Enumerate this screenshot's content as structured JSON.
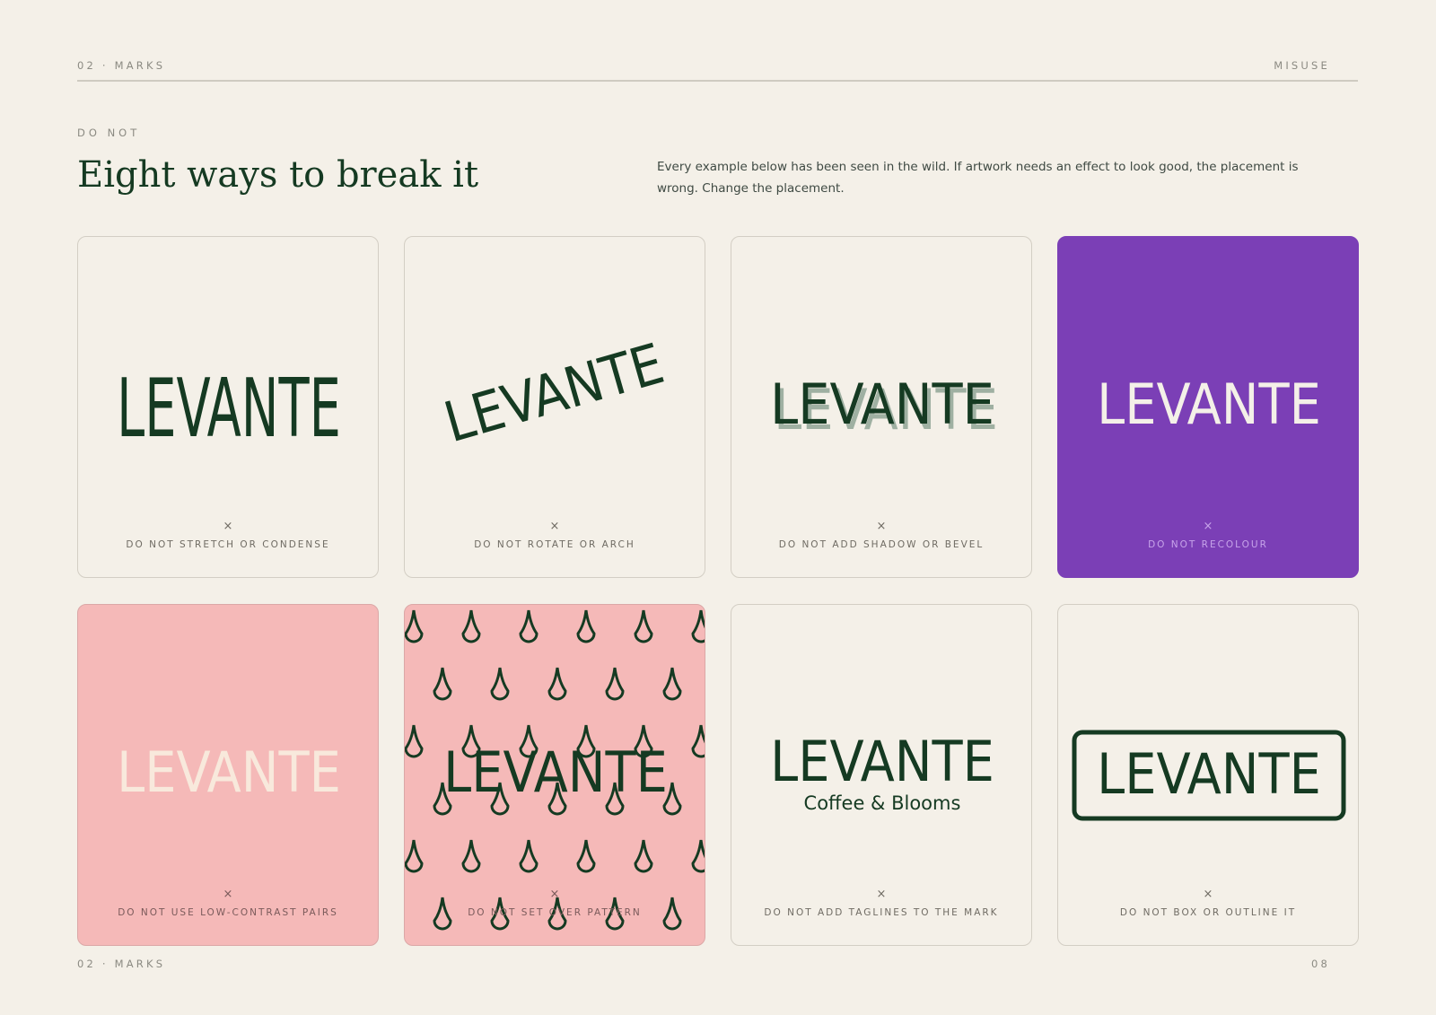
{
  "header": {
    "section": "02 · MARKS",
    "page_label": "MISUSE"
  },
  "kicker": "DO NOT",
  "title": "Eight ways to break it",
  "intro": "Every example below has been seen in the wild. If artwork needs an effect to look good, the placement is wrong. Change the placement.",
  "logo_word": "LEVANTE",
  "tagline": "Coffee & Blooms",
  "mark_glyph": "×",
  "colors": {
    "brand_green": "#153a22",
    "cream": "#f4f0e8",
    "purple": "#7b3fb6",
    "pink": "#f5b9b8"
  },
  "cards": [
    {
      "caption": "DO NOT STRETCH OR CONDENSE"
    },
    {
      "caption": "DO NOT ROTATE OR ARCH"
    },
    {
      "caption": "DO NOT ADD SHADOW OR BEVEL"
    },
    {
      "caption": "DO NOT RECOLOUR"
    },
    {
      "caption": "DO NOT USE LOW-CONTRAST PAIRS"
    },
    {
      "caption": "DO NOT SET OVER PATTERN"
    },
    {
      "caption": "DO NOT ADD TAGLINES TO THE MARK"
    },
    {
      "caption": "DO NOT BOX OR OUTLINE IT"
    }
  ],
  "footer": {
    "section": "02 · MARKS",
    "page_number": "08"
  }
}
